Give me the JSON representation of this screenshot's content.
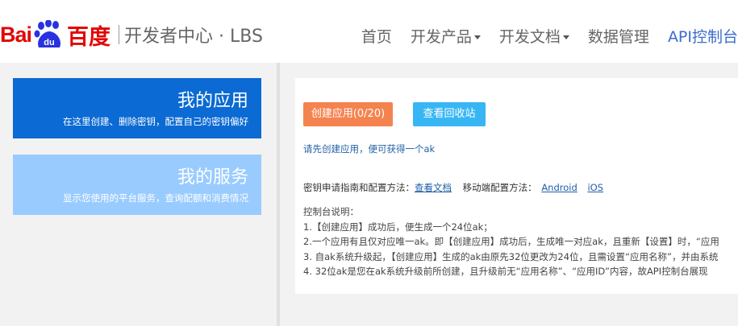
{
  "header": {
    "logo_bai": "Bai",
    "logo_du_char": "du",
    "logo_brand": "百度",
    "logo_subtitle": "开发者中心 · LBS",
    "nav": [
      {
        "label": "首页"
      },
      {
        "label": "开发产品"
      },
      {
        "label": "开发文档"
      },
      {
        "label": "数据管理"
      },
      {
        "label": "API控制台"
      }
    ]
  },
  "sidebar": {
    "apps": {
      "title": "我的应用",
      "desc": "在这里创建、删除密钥，配置自己的密钥偏好"
    },
    "services": {
      "title": "我的服务",
      "desc": "显示您使用的平台服务，查询配额和消费情况"
    }
  },
  "panel": {
    "create_button": "创建应用(0/20)",
    "recycle_button": "查看回收站",
    "hint": "请先创建应用，便可获得一个ak",
    "docs_prefix": "密钥申请指南和配置方法：",
    "docs_link": "查看文档",
    "mobile_prefix": "移动端配置方法：",
    "android_link": "Android",
    "ios_link": "iOS",
    "tips_title": "控制台说明：",
    "tips": [
      "1.【创建应用】成功后，便生成一个24位ak；",
      "2.一个应用有且仅对应唯一ak。即【创建应用】成功后，生成唯一对应ak，且重新【设置】时，“应用",
      "3. 自ak系统升级起，【创建应用】生成的ak由原先32位更改为24位，且需设置“应用名称”，并由系统",
      "4. 32位ak是您在ak系统升级前所创建，且升级前无“应用名称”、“应用ID”内容，故API控制台展现"
    ]
  },
  "colors": {
    "brand_red": "#e10602",
    "brand_blue": "#2932e1",
    "primary_card": "#0b6ad3",
    "secondary_card": "#99cbff",
    "create_button": "#f5834f",
    "recycle_button": "#38b6f4",
    "nav_active": "#3b6ccc"
  },
  "icons": {
    "logo_paw": "baidu-paw-icon",
    "dropdown": "caret-down-icon"
  }
}
